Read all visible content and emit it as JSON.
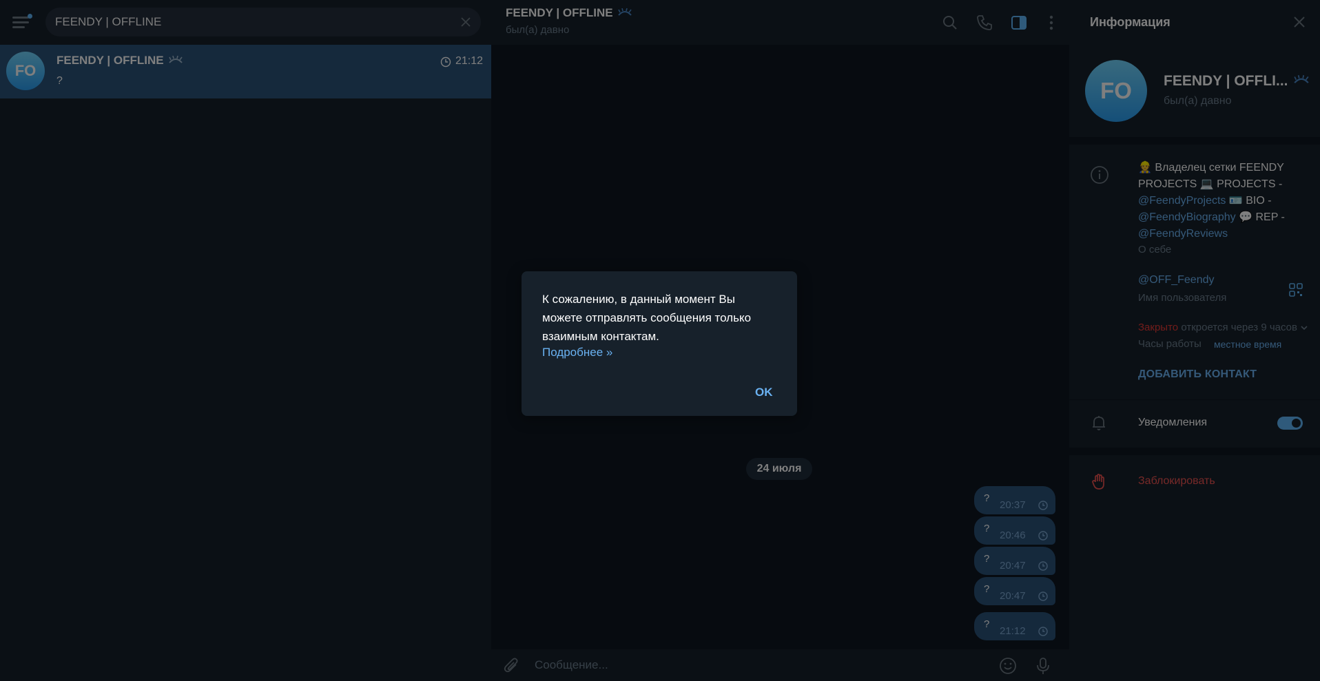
{
  "colors": {
    "accent": "#5eb5f7",
    "link": "#6ab2f2",
    "danger": "#ef5350",
    "selected_chat": "#2b5278",
    "panel_bg": "#17212b",
    "chat_bg": "#0e1621"
  },
  "search": {
    "value": "FEENDY | OFFLINE",
    "clear_icon": "close-icon"
  },
  "chat_list": [
    {
      "avatar_initials": "FO",
      "name": "FEENDY | OFFLINE",
      "status_icon": "clock-icon",
      "time": "21:12",
      "preview": "?"
    }
  ],
  "header": {
    "title": "FEENDY | OFFLINE",
    "status": "был(а) давно",
    "icons": [
      "search-icon",
      "phone-icon",
      "sidebar-toggle-icon",
      "more-vertical-icon"
    ]
  },
  "messages": {
    "date": "24 июля",
    "items": [
      {
        "text": "?",
        "time": "20:37"
      },
      {
        "text": "?",
        "time": "20:46"
      },
      {
        "text": "?",
        "time": "20:47"
      },
      {
        "text": "?",
        "time": "20:47"
      },
      {
        "text": "?",
        "time": "21:12"
      }
    ]
  },
  "composer": {
    "placeholder": "Сообщение..."
  },
  "info_panel": {
    "title": "Информация",
    "avatar_initials": "FO",
    "name": "FEENDY | OFFLI...",
    "status": "был(а) давно",
    "bio_parts": [
      {
        "text": "👷 Владелец сетки FEENDY PROJECTS 💻 PROJECTS - ",
        "link": false
      },
      {
        "text": "@FeendyProjects",
        "link": true
      },
      {
        "text": " 🪪 BIO - ",
        "link": false
      },
      {
        "text": "@FeendyBiography",
        "link": true
      },
      {
        "text": " 💬 REP - ",
        "link": false
      },
      {
        "text": "@FeendyReviews",
        "link": true
      }
    ],
    "bio_label": "О себе",
    "username": "@OFF_Feendy",
    "username_label": "Имя пользователя",
    "hours_status_red": "Закрыто",
    "hours_status_grey": "откроется через 9 часов",
    "hours_label": "Часы работы",
    "hours_local": "местное время",
    "add_contact": "ДОБАВИТЬ КОНТАКТ",
    "notifications_label": "Уведомления",
    "notifications_enabled": true,
    "block_label": "Заблокировать"
  },
  "dialog": {
    "text": "К сожалению, в данный момент Вы можете отправлять сообщения только взаимным контактам.",
    "link": "Подробнее »",
    "ok": "OK"
  }
}
